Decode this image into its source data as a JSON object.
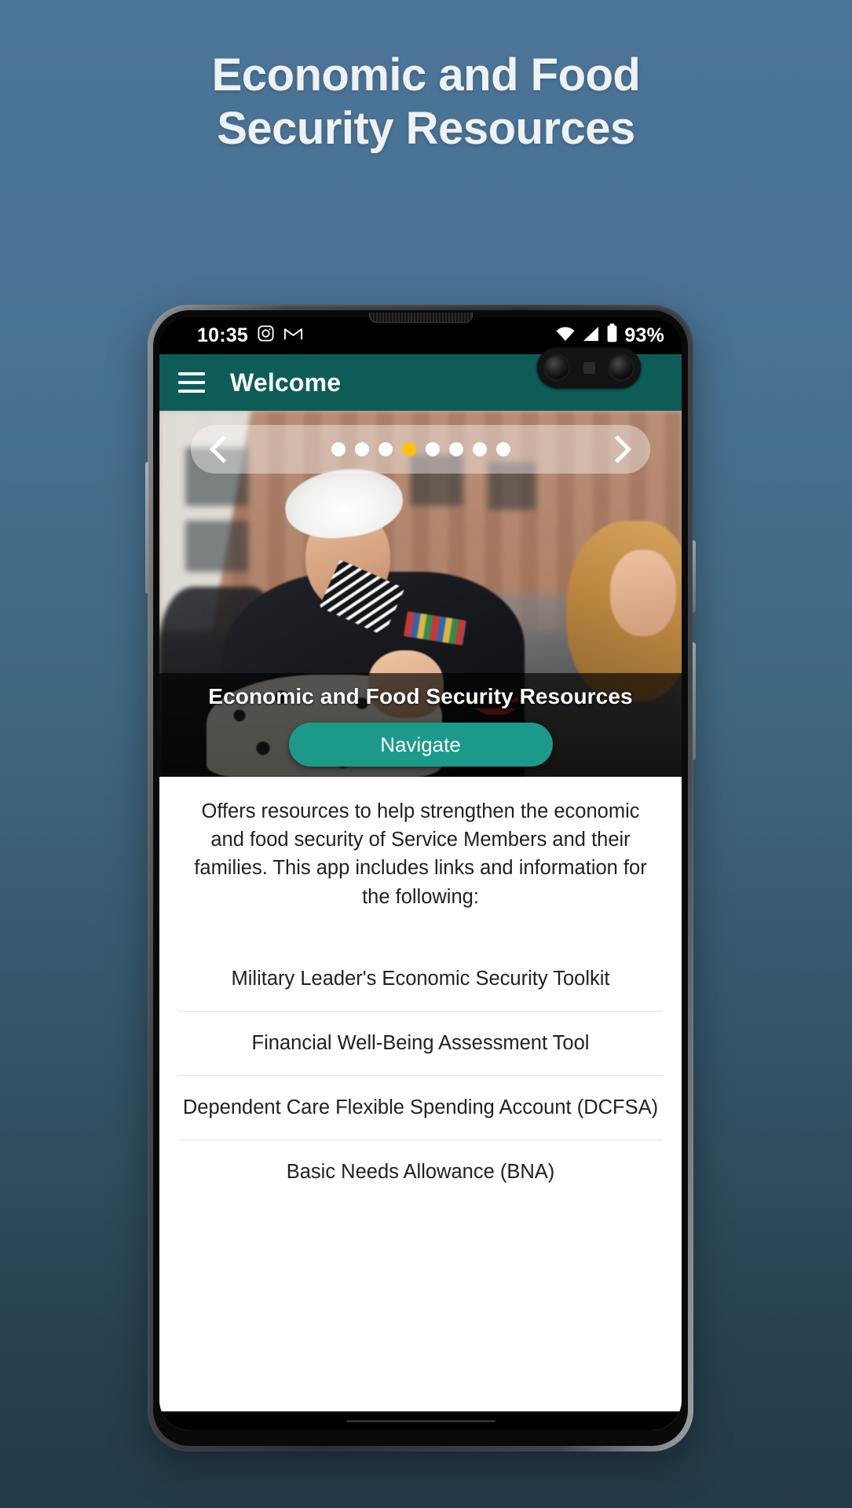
{
  "page": {
    "headline_line1": "Economic and Food",
    "headline_line2": "Security Resources",
    "background_top_color": "#4b7598",
    "background_bottom_color": "#233a48"
  },
  "status_bar": {
    "time": "10:35",
    "icons": [
      "instagram-icon",
      "gmail-icon",
      "wifi-icon",
      "cellular-signal-icon",
      "battery-icon"
    ],
    "battery_percent": "93%"
  },
  "app_bar": {
    "menu_icon": "hamburger-menu-icon",
    "title": "Welcome",
    "background_color": "#0e5c58"
  },
  "carousel": {
    "prev_icon": "chevron-left-icon",
    "next_icon": "chevron-right-icon",
    "total_slides": 8,
    "active_index": 3,
    "active_dot_color": "#ffc107",
    "dot_color": "#ffffff",
    "caption": "Economic and Food Security Resources",
    "navigate_label": "Navigate",
    "navigate_color": "#1b9a8a"
  },
  "content": {
    "intro": "Offers resources to help strengthen the economic and food security of Service Members and their families. This app includes links and information for the following:",
    "items": [
      {
        "label": "Military Leader's Economic Security Toolkit"
      },
      {
        "label": "Financial Well-Being Assessment Tool"
      },
      {
        "label": "Dependent Care Flexible Spending Account (DCFSA)"
      },
      {
        "label": "Basic Needs Allowance (BNA)"
      }
    ]
  }
}
